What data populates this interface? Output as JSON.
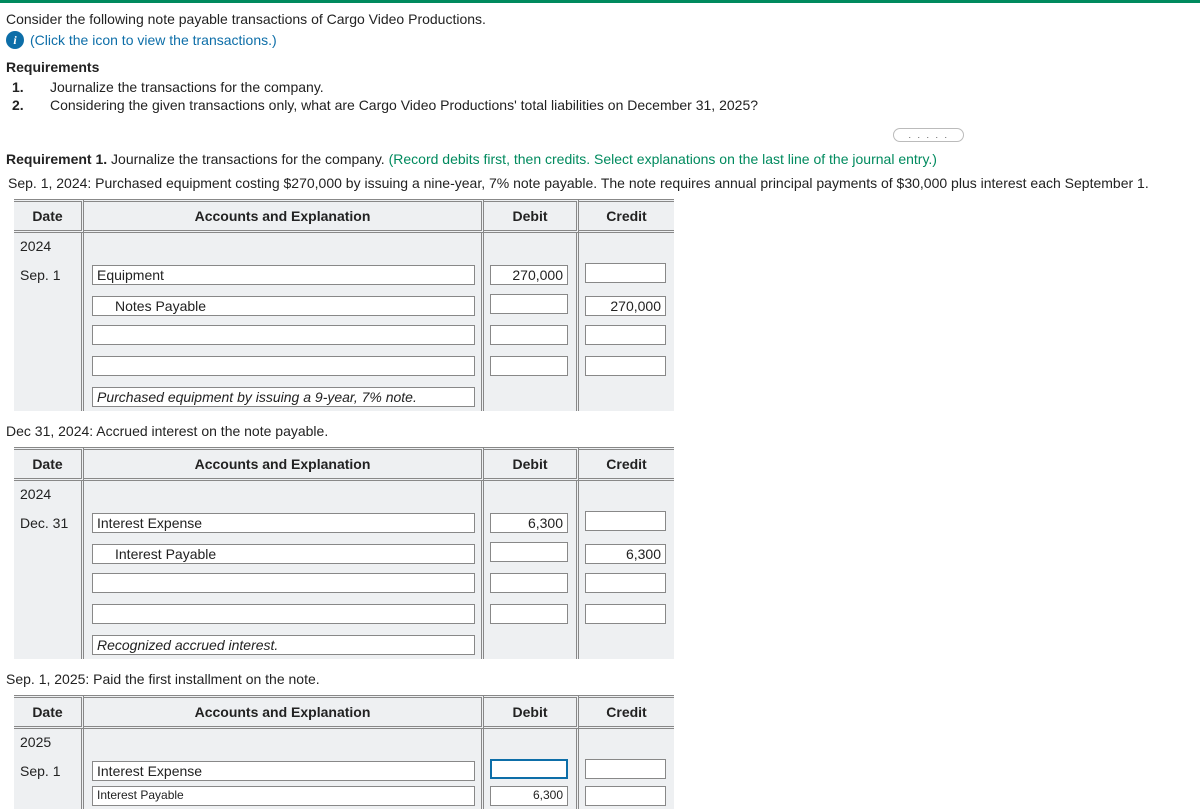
{
  "intro": "Consider the following note payable transactions of Cargo Video Productions.",
  "info_link": "(Click the icon to view the transactions.)",
  "requirements_heading": "Requirements",
  "requirements": [
    {
      "num": "1.",
      "text": "Journalize the transactions for the company."
    },
    {
      "num": "2.",
      "text": "Considering the given transactions only, what are Cargo Video Productions' total liabilities on December 31, 2025?"
    }
  ],
  "dots": ". . . . .",
  "req1": {
    "label": "Requirement 1.",
    "text": " Journalize the transactions for the company. ",
    "hint": "(Record debits first, then credits. Select explanations on the last line of the journal entry.)"
  },
  "headers": {
    "date": "Date",
    "acct": "Accounts and Explanation",
    "debit": "Debit",
    "credit": "Credit"
  },
  "t1": {
    "desc": "Sep. 1, 2024: Purchased equipment costing $270,000 by issuing a nine-year, 7% note payable. The note requires annual principal payments of $30,000 plus interest each September 1.",
    "year": "2024",
    "date": "Sep. 1",
    "rows": [
      {
        "acct": "Equipment",
        "indent": false,
        "debit": "270,000",
        "credit": ""
      },
      {
        "acct": "Notes Payable",
        "indent": true,
        "debit": "",
        "credit": "270,000"
      },
      {
        "acct": "",
        "debit": "",
        "credit": ""
      },
      {
        "acct": "",
        "debit": "",
        "credit": ""
      }
    ],
    "expl": "Purchased equipment by issuing a 9-year, 7% note."
  },
  "t2": {
    "desc": "Dec 31, 2024: Accrued interest on the note payable.",
    "year": "2024",
    "date": "Dec. 31",
    "rows": [
      {
        "acct": "Interest Expense",
        "indent": false,
        "debit": "6,300",
        "credit": ""
      },
      {
        "acct": "Interest Payable",
        "indent": true,
        "debit": "",
        "credit": "6,300"
      },
      {
        "acct": "",
        "debit": "",
        "credit": ""
      },
      {
        "acct": "",
        "debit": "",
        "credit": ""
      }
    ],
    "expl": "Recognized accrued interest."
  },
  "t3": {
    "desc": "Sep. 1, 2025: Paid the first installment on the note.",
    "year": "2025",
    "date": "Sep. 1",
    "rows": [
      {
        "acct": "Interest Expense",
        "indent": false,
        "debit": "",
        "credit": "",
        "active": true
      },
      {
        "acct": "Interest Payable",
        "indent": false,
        "debit": "6,300",
        "credit": "",
        "cut": true
      }
    ]
  }
}
